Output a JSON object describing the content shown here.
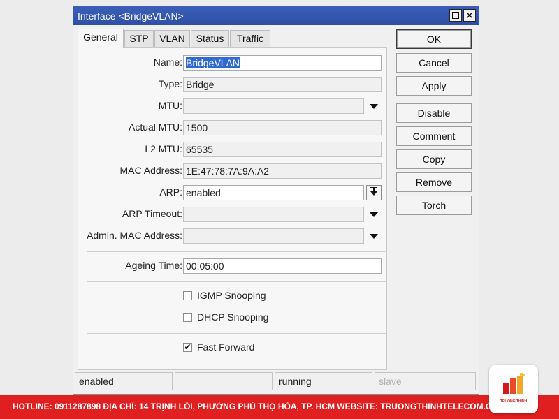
{
  "window": {
    "title": "Interface <BridgeVLAN>",
    "tabs": [
      {
        "label": "General"
      },
      {
        "label": "STP"
      },
      {
        "label": "VLAN"
      },
      {
        "label": "Status"
      },
      {
        "label": "Traffic"
      }
    ]
  },
  "form": {
    "name": {
      "label": "Name:",
      "value": "BridgeVLAN"
    },
    "type": {
      "label": "Type:",
      "value": "Bridge"
    },
    "mtu": {
      "label": "MTU:",
      "value": ""
    },
    "actual_mtu": {
      "label": "Actual MTU:",
      "value": "1500"
    },
    "l2_mtu": {
      "label": "L2 MTU:",
      "value": "65535"
    },
    "mac_address": {
      "label": "MAC Address:",
      "value": "1E:47:78:7A:9A:A2"
    },
    "arp": {
      "label": "ARP:",
      "value": "enabled"
    },
    "arp_timeout": {
      "label": "ARP Timeout:",
      "value": ""
    },
    "admin_mac": {
      "label": "Admin. MAC Address:",
      "value": ""
    },
    "ageing_time": {
      "label": "Ageing Time:",
      "value": "00:05:00"
    },
    "igmp_snooping": {
      "label": "IGMP Snooping",
      "checked": false
    },
    "dhcp_snooping": {
      "label": "DHCP Snooping",
      "checked": false
    },
    "fast_forward": {
      "label": "Fast Forward",
      "checked": true,
      "mark": "✔"
    }
  },
  "buttons": {
    "ok": "OK",
    "cancel": "Cancel",
    "apply": "Apply",
    "disable": "Disable",
    "comment": "Comment",
    "copy": "Copy",
    "remove": "Remove",
    "torch": "Torch"
  },
  "status": {
    "cell1": "enabled",
    "cell2": "",
    "cell3": "running",
    "cell4": "slave"
  },
  "footer": {
    "text": "HOTLINE: 0911287898     ĐỊA CHỈ: 14 TRỊNH LỖI, PHƯỜNG PHÚ THỌ HÒA, TP. HCM     WEBSITE: TRUONGTHINHTELECOM.COM",
    "logo_text": "TRUONG THINH"
  },
  "colors": {
    "titlebar": "#2f4fa6",
    "footer": "#e02020",
    "selection": "#2f6ad0"
  },
  "icons": {
    "close": "close-icon",
    "maximize": "maximize-icon",
    "dropdown": "chevron-down-icon",
    "checkmark": "checkmark-icon"
  }
}
